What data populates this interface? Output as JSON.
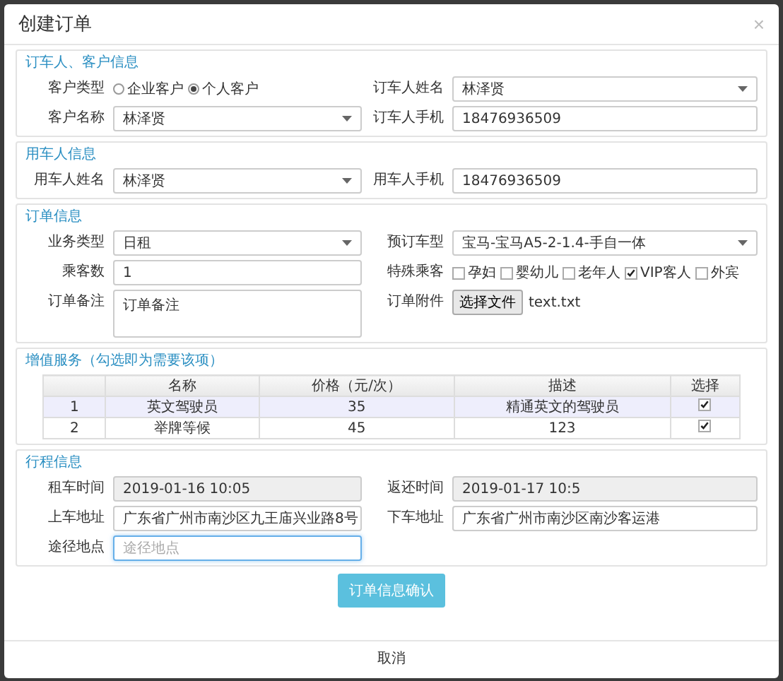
{
  "dialog": {
    "title": "创建订单",
    "close": "×"
  },
  "sections": [
    {
      "kind": "form",
      "title": "订车人、客户信息",
      "rows": [
        [
          {
            "kind": "radio",
            "label": "客户类型",
            "options": [
              {
                "label": "企业客户",
                "selected": false
              },
              {
                "label": "个人客户",
                "selected": true
              }
            ]
          },
          {
            "kind": "select",
            "label": "订车人姓名",
            "value": "林泽贤"
          }
        ],
        [
          {
            "kind": "select",
            "label": "客户名称",
            "value": "林泽贤"
          },
          {
            "kind": "input",
            "label": "订车人手机",
            "value": "18476936509"
          }
        ]
      ]
    },
    {
      "kind": "form",
      "title": "用车人信息",
      "rows": [
        [
          {
            "kind": "select",
            "label": "用车人姓名",
            "value": "林泽贤"
          },
          {
            "kind": "input",
            "label": "用车人手机",
            "value": "18476936509"
          }
        ]
      ]
    },
    {
      "kind": "form",
      "title": "订单信息",
      "rows": [
        [
          {
            "kind": "select",
            "label": "业务类型",
            "value": "日租"
          },
          {
            "kind": "select",
            "label": "预订车型",
            "value": "宝马-宝马A5-2-1.4-手自一体"
          }
        ],
        [
          {
            "kind": "input",
            "label": "乘客数",
            "value": "1"
          },
          {
            "kind": "checkboxes",
            "label": "特殊乘客",
            "options": [
              {
                "label": "孕妇",
                "checked": false
              },
              {
                "label": "婴幼儿",
                "checked": false
              },
              {
                "label": "老年人",
                "checked": false
              },
              {
                "label": "VIP客人",
                "checked": true
              },
              {
                "label": "外宾",
                "checked": false
              }
            ]
          }
        ],
        [
          {
            "kind": "textarea",
            "label": "订单备注",
            "value": "订单备注"
          },
          {
            "kind": "file",
            "label": "订单附件",
            "button": "选择文件",
            "filename": "text.txt"
          }
        ]
      ]
    },
    {
      "kind": "table",
      "title": "增值服务（勾选即为需要该项）",
      "columns": [
        "",
        "名称",
        "价格（元/次）",
        "描述",
        "选择"
      ],
      "rows": [
        {
          "selected": true,
          "cells": [
            "1",
            "英文驾驶员",
            "35",
            "精通英文的驾驶员"
          ],
          "checked": true
        },
        {
          "selected": false,
          "cells": [
            "2",
            "举牌等候",
            "45",
            "123"
          ],
          "checked": true
        }
      ]
    },
    {
      "kind": "form",
      "title": "行程信息",
      "rows": [
        [
          {
            "kind": "readonly",
            "label": "租车时间",
            "value": "2019-01-16 10:05"
          },
          {
            "kind": "readonly",
            "label": "返还时间",
            "value": "2019-01-17 10:5"
          }
        ],
        [
          {
            "kind": "input",
            "label": "上车地址",
            "value": "广东省广州市南沙区九王庙兴业路8号"
          },
          {
            "kind": "input",
            "label": "下车地址",
            "value": "广东省广州市南沙区南沙客运港"
          }
        ],
        [
          {
            "kind": "input",
            "label": "途径地点",
            "placeholder": "途径地点",
            "focused": true
          }
        ]
      ]
    }
  ],
  "submit": "订单信息确认",
  "footer": {
    "cancel": "取消"
  }
}
